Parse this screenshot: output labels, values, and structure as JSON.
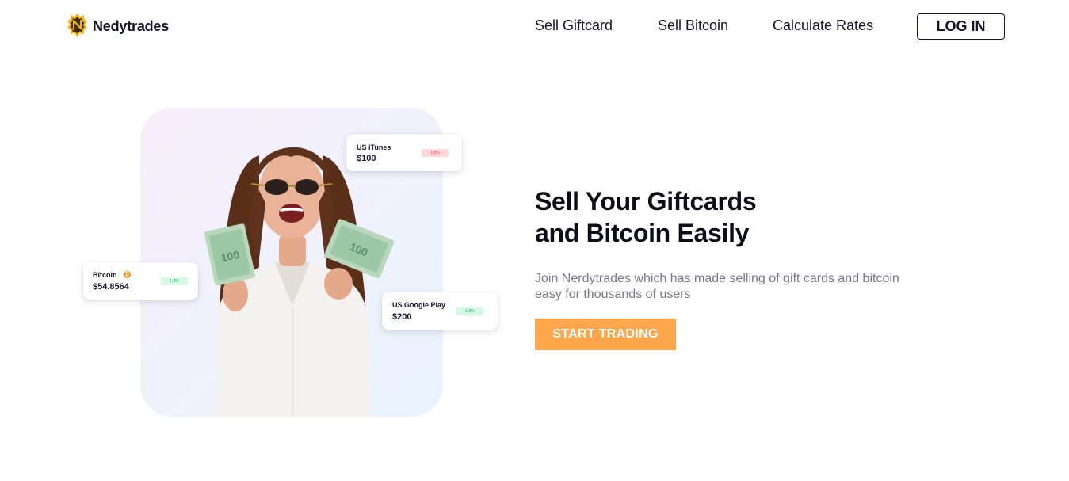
{
  "header": {
    "brand": "Nedytrades",
    "logo_icon": "nedytrades-logo-icon",
    "nav": [
      {
        "label": "Sell Giftcard"
      },
      {
        "label": "Sell Bitcoin"
      },
      {
        "label": "Calculate Rates"
      }
    ],
    "login_label": "LOG IN"
  },
  "hero": {
    "headline_line1": "Sell Your Giftcards",
    "headline_line2": "and Bitcoin Easily",
    "subtext": "Join Nerdytrades which has made selling of gift cards and bitcoin easy for thousands of users",
    "cta_label": "START TRADING",
    "accent_color": "#fda64b"
  },
  "rate_cards": [
    {
      "name": "US iTunes",
      "value": "$100",
      "badge": "1.8%",
      "badge_status": "down"
    },
    {
      "name": "Bitcoin",
      "value": "$54.8564",
      "badge": "1.8%",
      "badge_status": "up",
      "icon": "bitcoin-icon"
    },
    {
      "name": "US Google Play",
      "value": "$200",
      "badge": "1.8%",
      "badge_status": "up"
    }
  ]
}
